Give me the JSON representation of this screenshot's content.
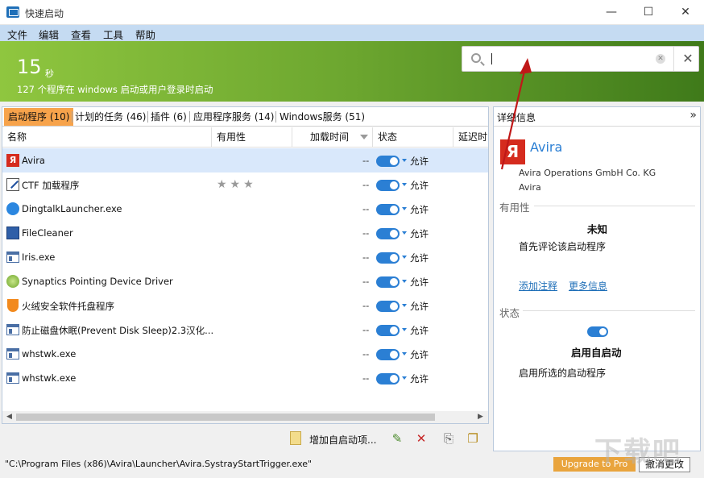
{
  "window": {
    "title": "快速启动",
    "minimize": "—",
    "maximize": "☐",
    "close": "✕"
  },
  "menu": [
    "文件",
    "编辑",
    "查看",
    "工具",
    "帮助"
  ],
  "banner": {
    "seconds": "15",
    "unit": "秒",
    "subtitle": "127 个程序在 windows 启动或用户登录时启动"
  },
  "search": {
    "value": "",
    "placeholder": ""
  },
  "tabs": [
    {
      "label": "启动程序 (10)",
      "active": true
    },
    {
      "label": "计划的任务 (46)"
    },
    {
      "label": "插件 (6)"
    },
    {
      "label": "应用程序服务 (14)"
    },
    {
      "label": "Windows服务 (51)"
    }
  ],
  "columns": {
    "name": "名称",
    "usefulness": "有用性",
    "load_time": "加载时间",
    "status": "状态",
    "delay": "延迟时"
  },
  "rows": [
    {
      "name": "Avira",
      "load": "--",
      "status": "允许",
      "icon": "avira-icon",
      "selected": true
    },
    {
      "name": "CTF 加载程序",
      "load": "--",
      "status": "允许",
      "icon": "ctf-icon",
      "stars": "★★★"
    },
    {
      "name": "DingtalkLauncher.exe",
      "load": "--",
      "status": "允许",
      "icon": "dingtalk-icon"
    },
    {
      "name": "FileCleaner",
      "load": "--",
      "status": "允许",
      "icon": "filecleaner-icon"
    },
    {
      "name": "Iris.exe",
      "load": "--",
      "status": "允许",
      "icon": "window-icon"
    },
    {
      "name": "Synaptics Pointing Device Driver",
      "load": "--",
      "status": "允许",
      "icon": "synaptics-icon"
    },
    {
      "name": "火绒安全软件托盘程序",
      "load": "--",
      "status": "允许",
      "icon": "huorong-icon"
    },
    {
      "name": "防止磁盘休眠(Prevent Disk Sleep)2.3汉化...",
      "load": "--",
      "status": "允许",
      "icon": "window-icon"
    },
    {
      "name": "whstwk.exe",
      "load": "--",
      "status": "允许",
      "icon": "window-icon"
    },
    {
      "name": "whstwk.exe",
      "load": "--",
      "status": "允许",
      "icon": "window-icon"
    }
  ],
  "toolbar": {
    "add_label": "增加自启动项..."
  },
  "details": {
    "header": "详细信息",
    "collapse": "»",
    "name": "Avira",
    "company": "Avira Operations GmbH  Co. KG",
    "product": "Avira",
    "usefulness_section": "有用性",
    "rating": "未知",
    "rating_prompt": "首先评论该启动程序",
    "add_comment": "添加注释",
    "more_info": "更多信息",
    "status_section": "状态",
    "enabled_label": "启用自启动",
    "enabled_desc": "启用所选的启动程序"
  },
  "statusbar": {
    "path": "\"C:\\Program Files (x86)\\Avira\\Launcher\\Avira.SystrayStartTrigger.exe\"",
    "upgrade": "Upgrade to Pro",
    "cancel": "撤消更改"
  },
  "colors": {
    "accent": "#2b7fd4",
    "tab_active": "#f7a34b",
    "banner_start": "#8fc63f",
    "banner_end": "#3f7a1a",
    "avira": "#d52b1e",
    "annotation_arrow": "#c01818"
  }
}
